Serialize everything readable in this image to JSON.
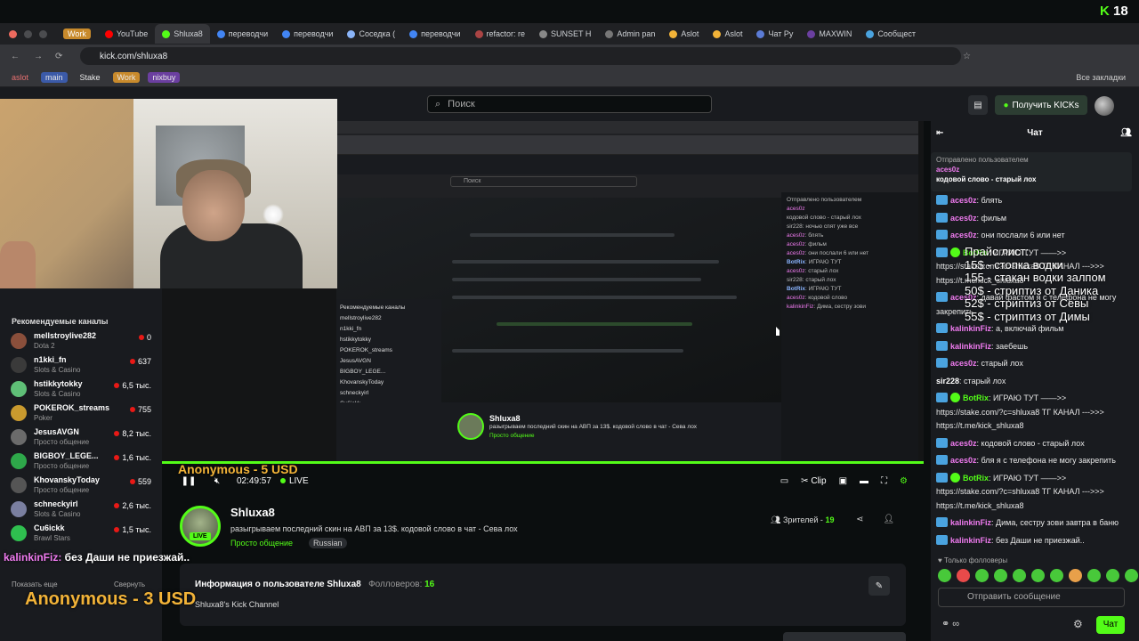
{
  "browser": {
    "tabs": [
      {
        "label": "Work",
        "active": false
      },
      {
        "label": "YouTube",
        "active": false
      },
      {
        "label": "Shluxa8",
        "active": true
      },
      {
        "label": "переводчи",
        "active": false
      },
      {
        "label": "переводчи",
        "active": false
      },
      {
        "label": "Соседка (",
        "active": false
      },
      {
        "label": "переводчи",
        "active": false
      },
      {
        "label": "refactor: re",
        "active": false
      },
      {
        "label": "SUNSET H",
        "active": false
      },
      {
        "label": "Admin pan",
        "active": false
      },
      {
        "label": "Aslot",
        "active": false
      },
      {
        "label": "Aslot",
        "active": false
      },
      {
        "label": "Чат Py",
        "active": false
      },
      {
        "label": "MAXWIN",
        "active": false
      },
      {
        "label": "Сообщест",
        "active": false
      }
    ],
    "address": "kick.com/shluxa8",
    "bookmarks": [
      "aslot",
      "main",
      "Stake",
      "Work",
      "nixbuy"
    ],
    "all_bookmarks": "Все закладки"
  },
  "corner_count": "18",
  "header": {
    "search_placeholder": "Поиск",
    "get_kicks": "Получить KICKs"
  },
  "sidebar": {
    "title": "Рекомендуемые каналы",
    "channels": [
      {
        "name": "mellstroylive282",
        "category": "Dota 2",
        "viewers": "0",
        "color": "#8a4f3b"
      },
      {
        "name": "n1kki_fn",
        "category": "Slots & Casino",
        "viewers": "637",
        "color": "#3a3a3a"
      },
      {
        "name": "hstikkytokky",
        "category": "Slots & Casino",
        "viewers": "6,5 тыс.",
        "color": "#5fbf77"
      },
      {
        "name": "POKEROK_streams",
        "category": "Poker",
        "viewers": "755",
        "color": "#c99a2e"
      },
      {
        "name": "JesusAVGN",
        "category": "Просто общение",
        "viewers": "8,2 тыс.",
        "color": "#6b6b6b"
      },
      {
        "name": "BIGBOY_LEGE...",
        "category": "Просто общение",
        "viewers": "1,6 тыс.",
        "color": "#2ea84a"
      },
      {
        "name": "KhovanskyToday",
        "category": "Просто общение",
        "viewers": "559",
        "color": "#555"
      },
      {
        "name": "schneckyirl",
        "category": "Slots & Casino",
        "viewers": "2,6 тыс.",
        "color": "#7a7fa0"
      },
      {
        "name": "Cu6ickk",
        "category": "Brawl Stars",
        "viewers": "1,5 тыс.",
        "color": "#2fbf4f"
      }
    ],
    "show_more": "Показать еще",
    "collapse": "Свернуть"
  },
  "player": {
    "donation": "Anonymous - 5 USD",
    "time": "02:49:57",
    "live": "LIVE",
    "clip": "Clip"
  },
  "channel": {
    "name": "Shluxa8",
    "live_badge": "LIVE",
    "title": "разыгрываем последний скин на АВП за 13$. кодовой слово в чат - Сева лох",
    "category": "Просто общение",
    "tag": "Russian",
    "viewers_label": "Зрителей -",
    "viewers": "19",
    "about_title": "Информация о пользователе Shluxa8",
    "followers_label": "Фолловеров:",
    "followers": "16",
    "about_text": "Shluxa8's Kick Channel"
  },
  "overlays": {
    "chat_user": "kalinkinFiz:",
    "chat_text": " без Даши не приезжай..",
    "donation": "Anonymous - 3 USD"
  },
  "playlist": [
    "Прайс лист:",
    "15$ - стопка водки",
    "155 - стакан водки залпом",
    "50$ - стриптиз от Даника",
    "52$ - стриптиз от Севы",
    "55$ - стриптиз от Димы"
  ],
  "chat": {
    "title": "Чат",
    "pinned_by": "Отправлено пользователем",
    "pinned_user": "aces0z",
    "pinned_text": "кодовой слово - старый лох",
    "messages": [
      {
        "user": "aces0z",
        "text": "блять",
        "badge": "mod",
        "color": "pink"
      },
      {
        "user": "aces0z",
        "text": "фильм",
        "badge": "mod",
        "color": "pink"
      },
      {
        "user": "aces0z",
        "text": "они послали 6 или нет",
        "badge": "mod",
        "color": "pink"
      },
      {
        "user": "BotRix",
        "text": "ИГРАЮ ТУТ ——>> https://stake.com/?c=shluxa8 ТГ КАНАЛ --->>> https://t.me/kick_shluxa8",
        "badge": "bot",
        "color": "green"
      },
      {
        "user": "aces0z",
        "text": "давай фастом я с телефона не могу закрепить",
        "badge": "mod",
        "color": "pink"
      },
      {
        "user": "kalinkinFiz",
        "text": "а, включай фильм",
        "badge": "mod",
        "color": "pink"
      },
      {
        "user": "kalinkinFiz",
        "text": "заебешь",
        "badge": "mod",
        "color": "pink"
      },
      {
        "user": "aces0z",
        "text": "старый лох",
        "badge": "mod",
        "color": "pink"
      },
      {
        "user": "sir228",
        "text": "старый лох",
        "badge": "none",
        "color": "white"
      },
      {
        "user": "BotRix",
        "text": "ИГРАЮ ТУТ ——>> https://stake.com/?c=shluxa8 ТГ КАНАЛ --->>> https://t.me/kick_shluxa8",
        "badge": "bot",
        "color": "green"
      },
      {
        "user": "aces0z",
        "text": "кодовой слово - старый лох",
        "badge": "mod",
        "color": "pink"
      },
      {
        "user": "aces0z",
        "text": "бля я с телефона не могу закрепить",
        "badge": "mod",
        "color": "pink"
      },
      {
        "user": "BotRix",
        "text": "ИГРАЮ ТУТ ——>> https://stake.com/?c=shluxa8 ТГ КАНАЛ --->>> https://t.me/kick_shluxa8",
        "badge": "bot",
        "color": "green"
      },
      {
        "user": "kalinkinFiz",
        "text": "Дима, сестру зови завтра в баню",
        "badge": "mod",
        "color": "pink"
      },
      {
        "user": "kalinkinFiz",
        "text": "без Даши не приезжай..",
        "badge": "mod",
        "color": "pink"
      }
    ],
    "followers_only": "Только фолловеры",
    "input_placeholder": "Отправить сообщение",
    "send": "Чат"
  }
}
